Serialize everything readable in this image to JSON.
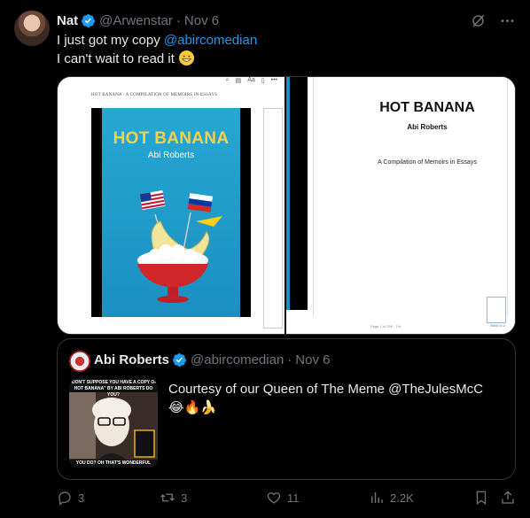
{
  "post": {
    "author_name": "Nat",
    "handle": "@Arwenstar",
    "separator": "·",
    "date": "Nov 6",
    "line1_prefix": "I just got my copy ",
    "line1_mention": "@abircomedian",
    "line2": "I can't wait to read it",
    "line2_emoji": "grinning-face-emoji"
  },
  "media": {
    "doc_header": "HOT BANANA : A COMPILATION OF MEMOIRS IN ESSAYS",
    "cover_title": "HOT BANANA",
    "cover_author": "Abi Roberts",
    "page_title": "HOT BANANA",
    "page_author": "Abi Roberts",
    "page_subtitle": "A Compilation of Memoirs in Essays",
    "page_count": "Page 1 of 259 · 1%",
    "thumb_label": "Back to 2",
    "toolbar_aa": "Aa"
  },
  "quote": {
    "author_name": "Abi Roberts",
    "handle": "@abircomedian",
    "separator": "·",
    "date": "Nov 6",
    "text": "Courtesy of our Queen of The Meme @TheJulesMcC",
    "emojis": "😂🔥🍌",
    "thumb_caption_top": "\"DON'T SUPPOSE YOU HAVE A COPY OF HOT BANANA\" BY ABI ROBERTS DO YOU?",
    "thumb_caption_bottom": "YOU DO? OH THAT'S WONDERFUL"
  },
  "actions": {
    "replies": "3",
    "reposts": "3",
    "likes": "11",
    "views": "2.2K"
  },
  "colors": {
    "accent": "#1d9bf0",
    "muted": "#71767b",
    "background": "#000000",
    "text": "#e7e9ea"
  }
}
